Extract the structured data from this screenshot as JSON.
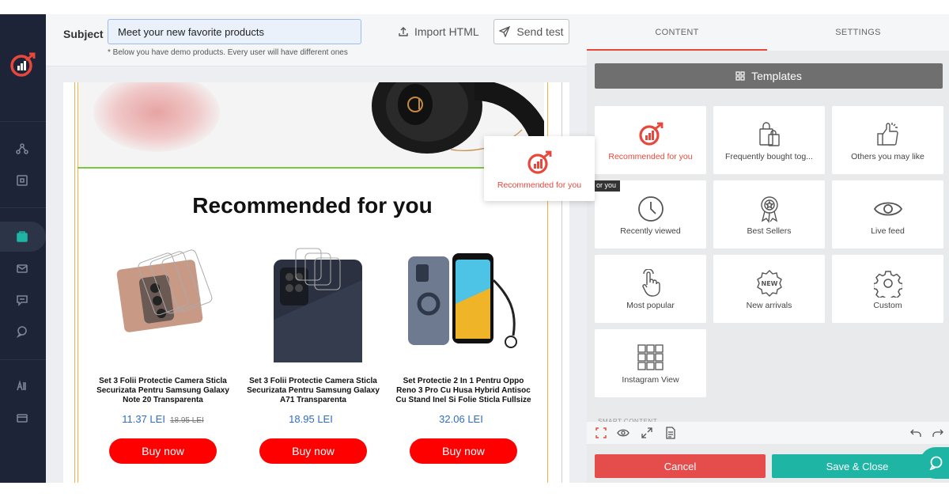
{
  "header": {
    "subject_label": "Subject",
    "subject_value": "Meet your new favorite products",
    "subject_note": "* Below you have demo products. Every user will have different ones",
    "import_label": "Import HTML",
    "send_test_label": "Send test"
  },
  "email": {
    "section_title": "Recommended for you",
    "products": [
      {
        "name": "Set 3 Folii Protectie Camera Sticla Securizata Pentru Samsung Galaxy Note 20 Transparenta",
        "price": "11.37 LEI",
        "old_price": "18.95 LEI",
        "button": "Buy now"
      },
      {
        "name": "Set 3 Folii Protectie Camera Sticla Securizata Pentru Samsung Galaxy A71 Transparenta",
        "price": "18.95 LEI",
        "old_price": "",
        "button": "Buy now"
      },
      {
        "name": "Set Protectie 2 In 1 Pentru Oppo Reno 3 Pro Cu Husa Hybrid Antisoc Cu Stand Inel Si Folie Sticla Fullsize",
        "price": "32.06 LEI",
        "old_price": "",
        "button": "Buy now"
      }
    ]
  },
  "drag_preview": {
    "label": "Recommended for you",
    "tooltip": "or you"
  },
  "panel": {
    "tabs": [
      "CONTENT",
      "SETTINGS"
    ],
    "active_tab": "CONTENT",
    "templates_label": "Templates",
    "tiles": [
      {
        "label": "Recommended for you",
        "icon": "recommend-logo-icon",
        "active": true
      },
      {
        "label": "Frequently bought tog...",
        "icon": "shopping-bags-icon"
      },
      {
        "label": "Others you may like",
        "icon": "thumbs-up-icon"
      },
      {
        "label": "Recently viewed",
        "icon": "clock-icon"
      },
      {
        "label": "Best Sellers",
        "icon": "award-badge-icon"
      },
      {
        "label": "Live feed",
        "icon": "eye-icon"
      },
      {
        "label": "Most popular",
        "icon": "pointer-hand-icon"
      },
      {
        "label": "New arrivals",
        "icon": "new-badge-icon"
      },
      {
        "label": "Custom",
        "icon": "gear-icon"
      },
      {
        "label": "Instagram View",
        "icon": "grid-icon"
      }
    ],
    "smart_content_peek": "SMART CONTENT",
    "cancel_label": "Cancel",
    "save_label": "Save & Close"
  },
  "colors": {
    "brand_red": "#e8483b",
    "buy_red": "#ff0000",
    "price_blue": "#2e6cc7",
    "sidebar_bg": "#1e2437",
    "teal": "#1fb5a5",
    "cancel_red": "#e54d4d"
  }
}
